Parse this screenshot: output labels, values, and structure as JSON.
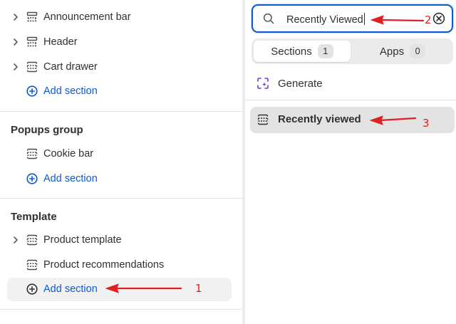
{
  "left_panel": {
    "header_items": [
      {
        "label": "Announcement bar",
        "expandable": true
      },
      {
        "label": "Header",
        "expandable": true
      },
      {
        "label": "Cart drawer",
        "expandable": true
      }
    ],
    "header_add_label": "Add section",
    "popups_group": {
      "title": "Popups group",
      "items": [
        {
          "label": "Cookie bar"
        }
      ],
      "add_label": "Add section"
    },
    "template_group": {
      "title": "Template",
      "items": [
        {
          "label": "Product template",
          "expandable": true
        },
        {
          "label": "Product recommendations",
          "expandable": false
        }
      ],
      "add_label": "Add section"
    }
  },
  "right_panel": {
    "search": {
      "value": "Recently Viewed"
    },
    "tabs": [
      {
        "label": "Sections",
        "count": "1",
        "active": true
      },
      {
        "label": "Apps",
        "count": "0",
        "active": false
      }
    ],
    "generate_label": "Generate",
    "results": [
      {
        "label": "Recently viewed"
      }
    ]
  },
  "annotations": {
    "step1": "1",
    "step2": "2",
    "step3": "3",
    "color": "#e02020"
  },
  "colors": {
    "accent": "#0b5ad1",
    "highlight_bg": "#f1f1f1",
    "result_bg": "#e3e3e3"
  },
  "icons": {
    "chevron": "chevron-right-icon",
    "section": "section-block-icon",
    "header_section": "header-section-icon",
    "add": "plus-circle-icon",
    "search": "search-icon",
    "clear": "clear-circle-icon",
    "generate": "sparkle-generate-icon"
  }
}
